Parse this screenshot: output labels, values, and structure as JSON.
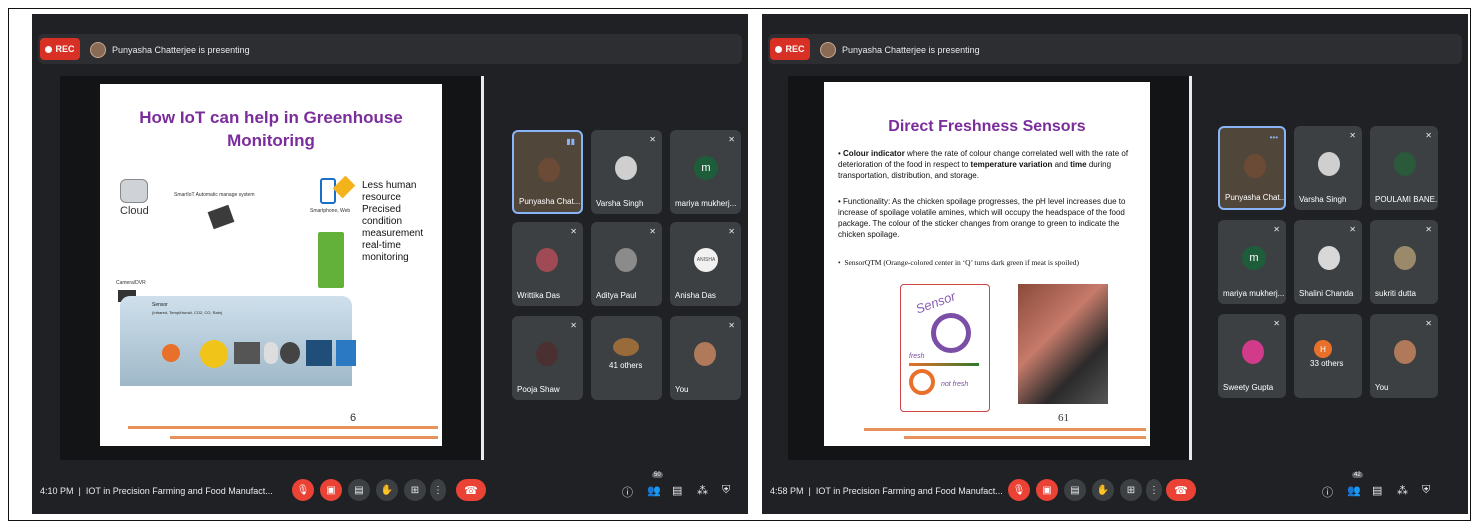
{
  "left": {
    "rec_label": "REC",
    "presenting": "Punyasha Chatterjee is presenting",
    "slide": {
      "title_line1": "How IoT can help in Greenhouse",
      "title_line2": "Monitoring",
      "cloud": "Cloud",
      "smart_label": "SmartIoT Automatic manage system",
      "phone_label": "Smartphone, Web",
      "camera_label": "Camera/DVR",
      "sensor_label": "Sensor",
      "sensor_sub": "(Infrared, Temp/Humid, CO2, CO, Rain)",
      "bullets": [
        "Less human resource",
        "Precised condition measurement",
        "real-time monitoring"
      ],
      "page": "6"
    },
    "participants": [
      {
        "name": "Punyasha Chat...",
        "active": true
      },
      {
        "name": "Varsha Singh"
      },
      {
        "name": "mariya mukherj...",
        "letter": "m"
      },
      {
        "name": "Writtika Das"
      },
      {
        "name": "Aditya Paul"
      },
      {
        "name": "Anisha Das",
        "logo": "ANISHA"
      },
      {
        "name": "Pooja Shaw"
      },
      {
        "name": "41 others"
      },
      {
        "name": "You"
      }
    ],
    "time": "4:10 PM",
    "meeting": "IOT in Precision Farming and Food Manufact...",
    "people_count": "50"
  },
  "right": {
    "rec_label": "REC",
    "presenting": "Punyasha Chatterjee is presenting",
    "slide": {
      "title": "Direct Freshness Sensors",
      "b1_bold": "Colour indicator",
      "b1_rest": " where the rate of colour change correlated well with the rate of deterioration of the food in respect to ",
      "b1_bold2": "temperature variation",
      "b1_and": " and ",
      "b1_bold3": "time",
      "b1_tail": " during transportation, distribution, and storage.",
      "b2": "Functionality: As the chicken spoilage progresses, the pH level increases due to increase of spoilage volatile amines, which will occupy the headspace of the food package. The colour of the sticker changes from orange to green to indicate the chicken spoilage.",
      "b3": "SensorQTM (Orange-colored center in ‘Q’ turns dark green if meat is spoiled)",
      "fresh": "fresh",
      "not_fresh": "not fresh",
      "sensor_word": "Sensor",
      "page": "61"
    },
    "participants": [
      {
        "name": "Punyasha Chat...",
        "active": true
      },
      {
        "name": "Varsha Singh"
      },
      {
        "name": "POULAMI BANE..."
      },
      {
        "name": "mariya mukherj...",
        "letter": "m"
      },
      {
        "name": "Shalini Chanda"
      },
      {
        "name": "sukriti dutta"
      },
      {
        "name": "Sweety Gupta"
      },
      {
        "name": "33 others",
        "letter": "H"
      },
      {
        "name": "You"
      }
    ],
    "time": "4:58 PM",
    "meeting": "IOT in Precision Farming and Food Manufact...",
    "people_count": "42"
  },
  "colors": {
    "meet_bg": "#202124",
    "tile": "#3c4043",
    "red": "#ea4335",
    "title_purple": "#7b2d9b",
    "accent_orange": "#e8915a"
  },
  "icons": [
    "mic-off-icon",
    "camera-off-icon",
    "captions-icon",
    "raise-hand-icon",
    "present-icon",
    "more-icon",
    "leave-call-icon",
    "info-icon",
    "people-icon",
    "chat-icon",
    "activities-icon",
    "host-controls-icon"
  ]
}
